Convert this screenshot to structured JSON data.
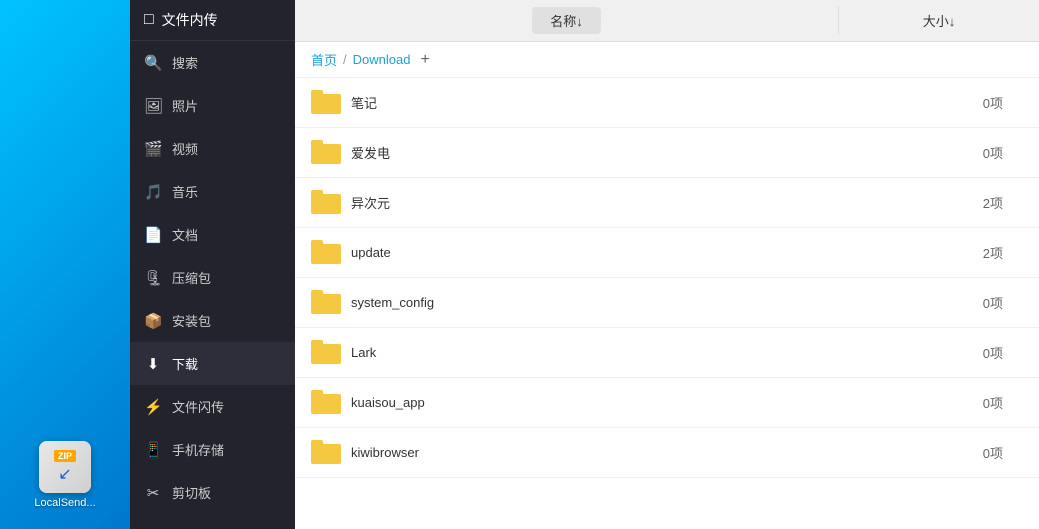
{
  "desktop": {
    "icon_label": "LocalSend...",
    "zip_label": "ZIP",
    "arrow_char": "↙"
  },
  "sidebar": {
    "header": {
      "icon": "□",
      "label": "文件内传"
    },
    "items": [
      {
        "id": "search",
        "icon": "🔍",
        "label": "搜索"
      },
      {
        "id": "photos",
        "icon": "🖼",
        "label": "照片"
      },
      {
        "id": "video",
        "icon": "🎬",
        "label": "视频"
      },
      {
        "id": "music",
        "icon": "🎵",
        "label": "音乐"
      },
      {
        "id": "docs",
        "icon": "📄",
        "label": "文档"
      },
      {
        "id": "zip",
        "icon": "🗜",
        "label": "压缩包"
      },
      {
        "id": "install",
        "icon": "📦",
        "label": "安装包"
      },
      {
        "id": "download",
        "icon": "⬇",
        "label": "下载"
      },
      {
        "id": "flash",
        "icon": "⚡",
        "label": "文件闪传"
      },
      {
        "id": "phone",
        "icon": "📱",
        "label": "手机存储"
      },
      {
        "id": "clipboard",
        "icon": "✂",
        "label": "剪切板"
      }
    ]
  },
  "main": {
    "table_header": {
      "name_col": "名称↓",
      "size_col": "大小↓"
    },
    "breadcrumb": {
      "home": "首页",
      "sep": "/",
      "current": "Download",
      "add": "+"
    },
    "files": [
      {
        "name": "笔记",
        "size": "0项",
        "type": "folder"
      },
      {
        "name": "爱发电",
        "size": "0项",
        "type": "folder"
      },
      {
        "name": "异次元",
        "size": "2项",
        "type": "folder"
      },
      {
        "name": "update",
        "size": "2项",
        "type": "folder"
      },
      {
        "name": "system_config",
        "size": "0项",
        "type": "folder"
      },
      {
        "name": "Lark",
        "size": "0项",
        "type": "folder"
      },
      {
        "name": "kuaisou_app",
        "size": "0项",
        "type": "folder"
      },
      {
        "name": "kiwibrowser",
        "size": "0项",
        "type": "folder"
      }
    ]
  }
}
